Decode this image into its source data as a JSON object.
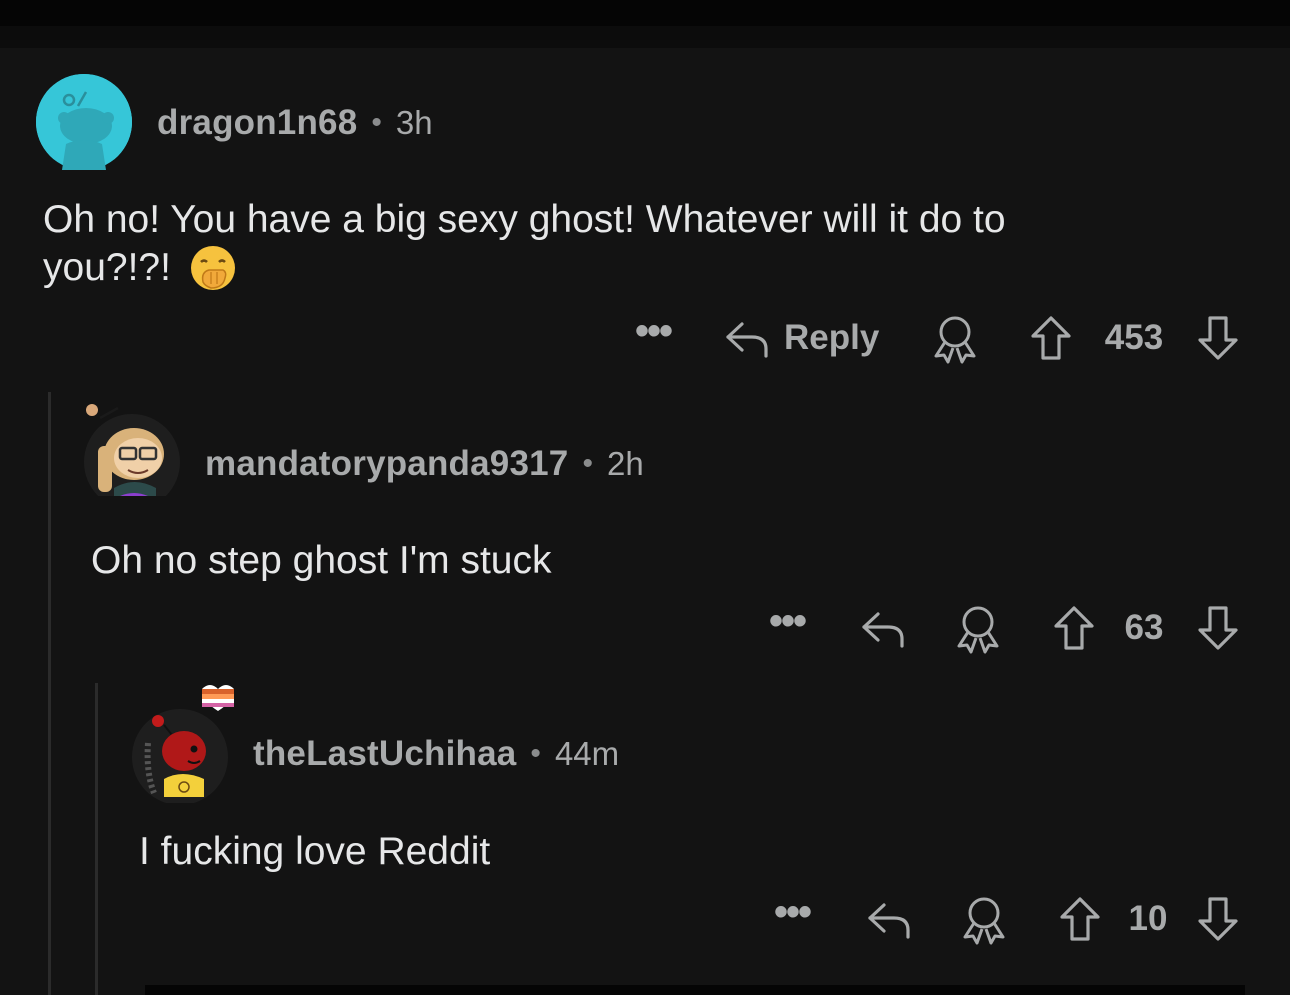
{
  "comments": [
    {
      "username": "dragon1n68",
      "separator": "•",
      "time": "3h",
      "body_line1": "Oh no! You have a big sexy ghost! Whatever will it do to",
      "body_line2": "you?!?!",
      "emoji": "🤭",
      "reply_label": "Reply",
      "votes": "453",
      "more": "•••",
      "avatar_color": "#36c6d8"
    },
    {
      "username": "mandatorypanda9317",
      "separator": "•",
      "time": "2h",
      "body": "Oh no step ghost I'm stuck",
      "votes": "63",
      "more": "•••"
    },
    {
      "username": "theLastUchihaa",
      "separator": "•",
      "time": "44m",
      "body": "I fucking love Reddit",
      "votes": "10",
      "more": "•••"
    }
  ],
  "icons": {
    "reply": "reply-arrow-icon",
    "award": "award-ribbon-icon",
    "upvote": "upvote-arrow-icon",
    "downvote": "downvote-arrow-icon",
    "more": "more-options-icon"
  },
  "colors": {
    "background": "#131313",
    "text": "#e6e7e8",
    "muted": "#a8aaab",
    "thread_line": "#2b2b2b"
  }
}
